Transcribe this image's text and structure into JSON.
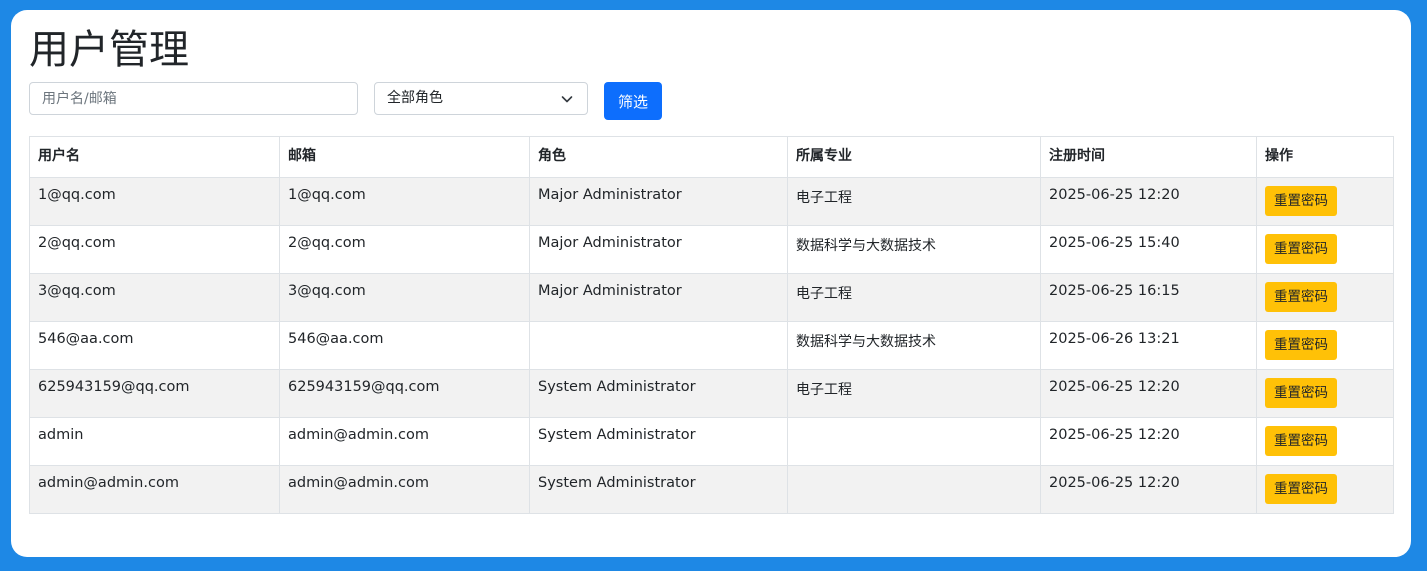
{
  "page": {
    "title": "用户管理"
  },
  "filters": {
    "search_placeholder": "用户名/邮箱",
    "role_select_value": "全部角色",
    "filter_button_label": "筛选"
  },
  "table": {
    "headers": [
      "用户名",
      "邮箱",
      "角色",
      "所属专业",
      "注册时间",
      "操作"
    ],
    "action_label": "重置密码",
    "rows": [
      {
        "username": "1@qq.com",
        "email": "1@qq.com",
        "role": "Major Administrator",
        "major": "电子工程",
        "registered": "2025-06-25 12:20"
      },
      {
        "username": "2@qq.com",
        "email": "2@qq.com",
        "role": "Major Administrator",
        "major": "数据科学与大数据技术",
        "registered": "2025-06-25 15:40"
      },
      {
        "username": "3@qq.com",
        "email": "3@qq.com",
        "role": "Major Administrator",
        "major": "电子工程",
        "registered": "2025-06-25 16:15"
      },
      {
        "username": "546@aa.com",
        "email": "546@aa.com",
        "role": "",
        "major": "数据科学与大数据技术",
        "registered": "2025-06-26 13:21"
      },
      {
        "username": "625943159@qq.com",
        "email": "625943159@qq.com",
        "role": "System Administrator",
        "major": "电子工程",
        "registered": "2025-06-25 12:20"
      },
      {
        "username": "admin",
        "email": "admin@admin.com",
        "role": "System Administrator",
        "major": "",
        "registered": "2025-06-25 12:20"
      },
      {
        "username": "admin@admin.com",
        "email": "admin@admin.com",
        "role": "System Administrator",
        "major": "",
        "registered": "2025-06-25 12:20"
      }
    ]
  },
  "colors": {
    "background": "#1e88e5",
    "primary": "#0d6efd",
    "warning": "#ffc107",
    "striped_row": "#f2f2f2"
  },
  "icons": {
    "select_arrow": "chevron-down-icon"
  }
}
